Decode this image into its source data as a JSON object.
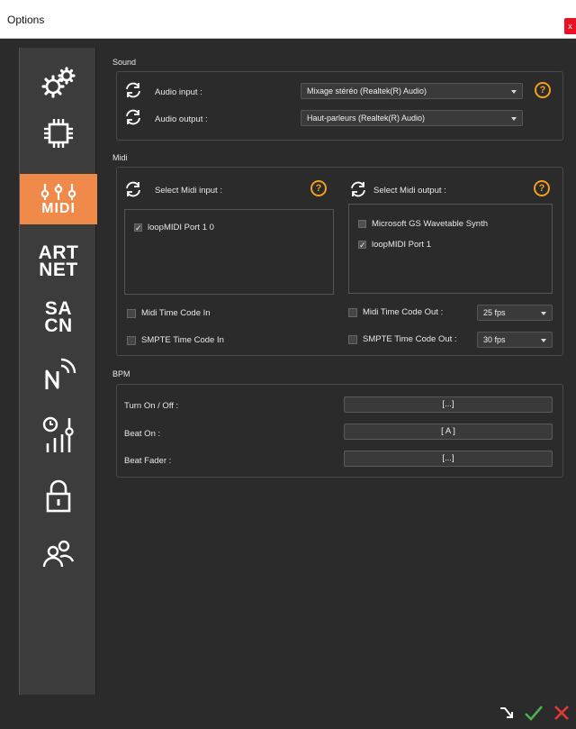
{
  "window": {
    "title": "Options",
    "close_label": "x"
  },
  "sidebar": {
    "items": [
      {
        "name": "general",
        "icon": "gears-icon"
      },
      {
        "name": "hardware",
        "icon": "chip-icon"
      },
      {
        "name": "midi",
        "icon": "midi-sliders-icon",
        "label": "MIDI",
        "active": true
      },
      {
        "name": "artnet",
        "label_line1": "ART",
        "label_line2": "NET"
      },
      {
        "name": "sacn",
        "label_line1": "SA",
        "label_line2": "CN"
      },
      {
        "name": "network",
        "icon": "network-icon"
      },
      {
        "name": "timecode",
        "icon": "clock-sliders-icon"
      },
      {
        "name": "security",
        "icon": "lock-icon"
      },
      {
        "name": "users",
        "icon": "users-icon"
      }
    ]
  },
  "sound": {
    "title": "Sound",
    "audio_input_label": "Audio input :",
    "audio_input_value": "Mixage stéréo (Realtek(R) Audio)",
    "audio_output_label": "Audio output :",
    "audio_output_value": "Haut-parleurs (Realtek(R) Audio)"
  },
  "midi": {
    "title": "Midi",
    "input_label": "Select Midi input :",
    "output_label": "Select Midi output :",
    "inputs": [
      {
        "label": "loopMIDI Port 1 0",
        "checked": true
      }
    ],
    "outputs": [
      {
        "label": "Microsoft GS Wavetable Synth",
        "checked": false
      },
      {
        "label": "loopMIDI Port 1",
        "checked": true
      }
    ],
    "mtc_in_label": "Midi Time Code In",
    "smpte_in_label": "SMPTE Time Code In",
    "mtc_out_label": "Midi Time Code Out :",
    "mtc_out_value": "25 fps",
    "smpte_out_label": "SMPTE Time Code Out :",
    "smpte_out_value": "30 fps",
    "check_mark": "✓",
    "help_symbol": "?"
  },
  "bpm": {
    "title": "BPM",
    "rows": [
      {
        "label": "Turn On / Off :",
        "value": "[...]"
      },
      {
        "label": "Beat On :",
        "value": "[ A ]"
      },
      {
        "label": "Beat Fader :",
        "value": "[...]"
      }
    ]
  },
  "colors": {
    "accent": "#f08a4b",
    "help": "#f0a020",
    "ok": "#4caf50",
    "cancel": "#e53935"
  }
}
